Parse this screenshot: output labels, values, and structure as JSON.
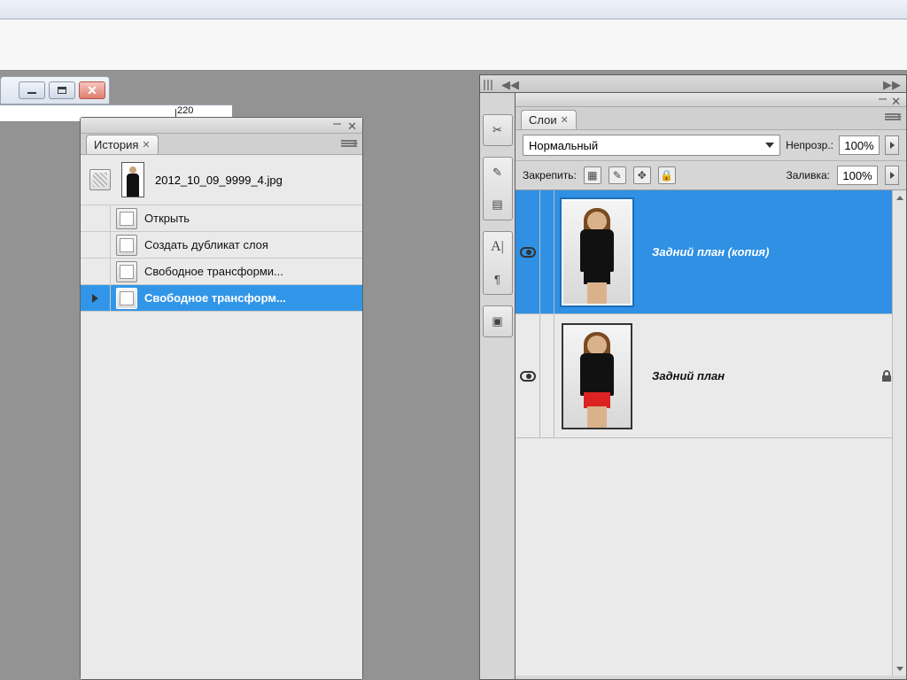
{
  "ruler": {
    "label": "220"
  },
  "history": {
    "tab": "История",
    "snapshot_filename": "2012_10_09_9999_4.jpg",
    "items": [
      {
        "label": "Открыть",
        "selected": false,
        "current": false
      },
      {
        "label": "Создать дубликат слоя",
        "selected": false,
        "current": false
      },
      {
        "label": "Свободное трансформи...",
        "selected": false,
        "current": false
      },
      {
        "label": "Свободное трансформ...",
        "selected": true,
        "current": true
      }
    ]
  },
  "layers": {
    "tab": "Слои",
    "blend_mode": "Нормальный",
    "opacity_label": "Непрозр.:",
    "opacity_value": "100%",
    "lock_label": "Закрепить:",
    "fill_label": "Заливка:",
    "fill_value": "100%",
    "items": [
      {
        "name": "Задний план (копия)",
        "visible": true,
        "locked": false,
        "selected": true
      },
      {
        "name": "Задний план",
        "visible": true,
        "locked": true,
        "selected": false
      }
    ]
  }
}
